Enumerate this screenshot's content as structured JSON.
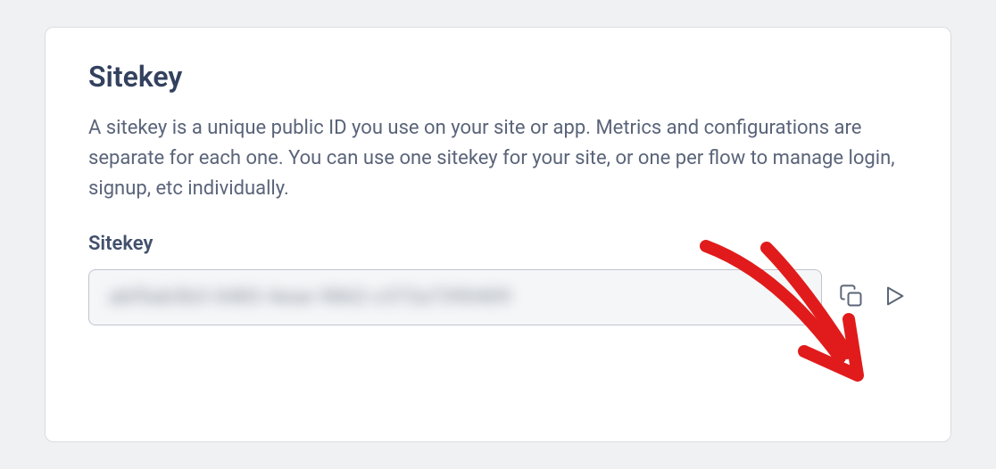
{
  "card": {
    "title": "Sitekey",
    "description": "A sitekey is a unique public ID you use on your site or app. Metrics and configurations are separate for each one. You can use one sitekey for your site, or one per flow to manage login, signup, etc individually.",
    "field_label": "Sitekey",
    "sitekey_value": "abf5ab3b3-0483-4eae-9862-c372a7390409"
  }
}
